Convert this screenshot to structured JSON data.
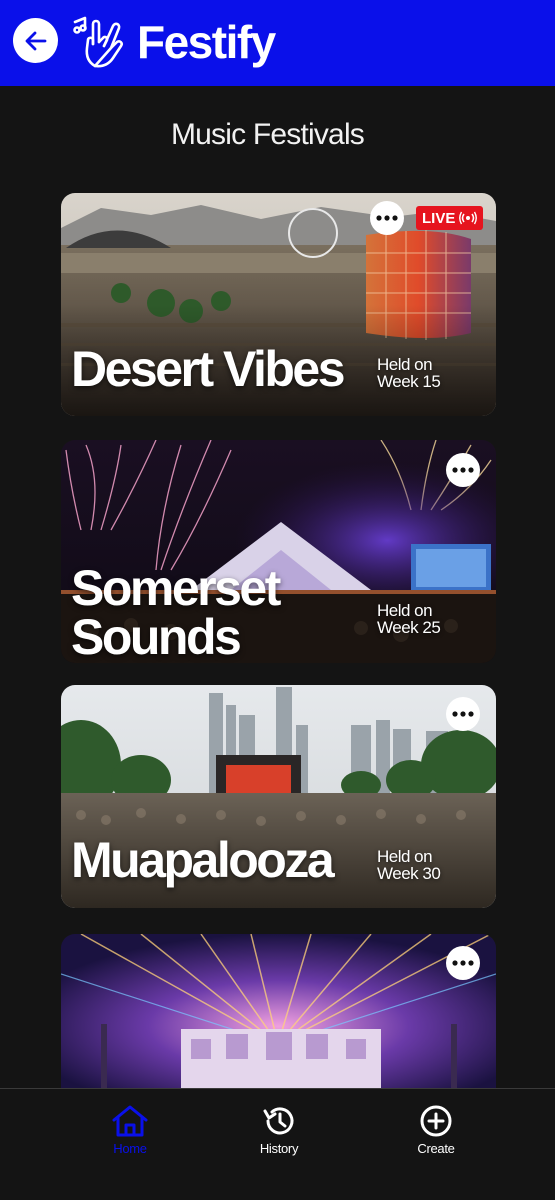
{
  "header": {
    "app_title": "Festify",
    "brand_color": "#0a10ea",
    "back_icon": "arrow-left-icon",
    "logo_icon": "hand-music-icon"
  },
  "main": {
    "title": "Music Festivals",
    "festivals": [
      {
        "name": "Desert Vibes",
        "held_line1": "Held on",
        "held_line2": "Week 15",
        "live": "LIVE",
        "more_icon": "more-horizontal-icon"
      },
      {
        "name_line1": "Somerset",
        "name_line2": "Sounds",
        "held_line1": "Held on",
        "held_line2": "Week 25",
        "more_icon": "more-horizontal-icon"
      },
      {
        "name": "Muapalooza",
        "held_line1": "Held on",
        "held_line2": "Week 30",
        "more_icon": "more-horizontal-icon"
      },
      {
        "more_icon": "more-horizontal-icon"
      }
    ]
  },
  "bottom_nav": {
    "active_color": "#0a10ea",
    "items": [
      {
        "label": "Home",
        "icon": "home-icon",
        "active": true
      },
      {
        "label": "History",
        "icon": "history-icon",
        "active": false
      },
      {
        "label": "Create",
        "icon": "plus-circle-icon",
        "active": false
      }
    ]
  }
}
